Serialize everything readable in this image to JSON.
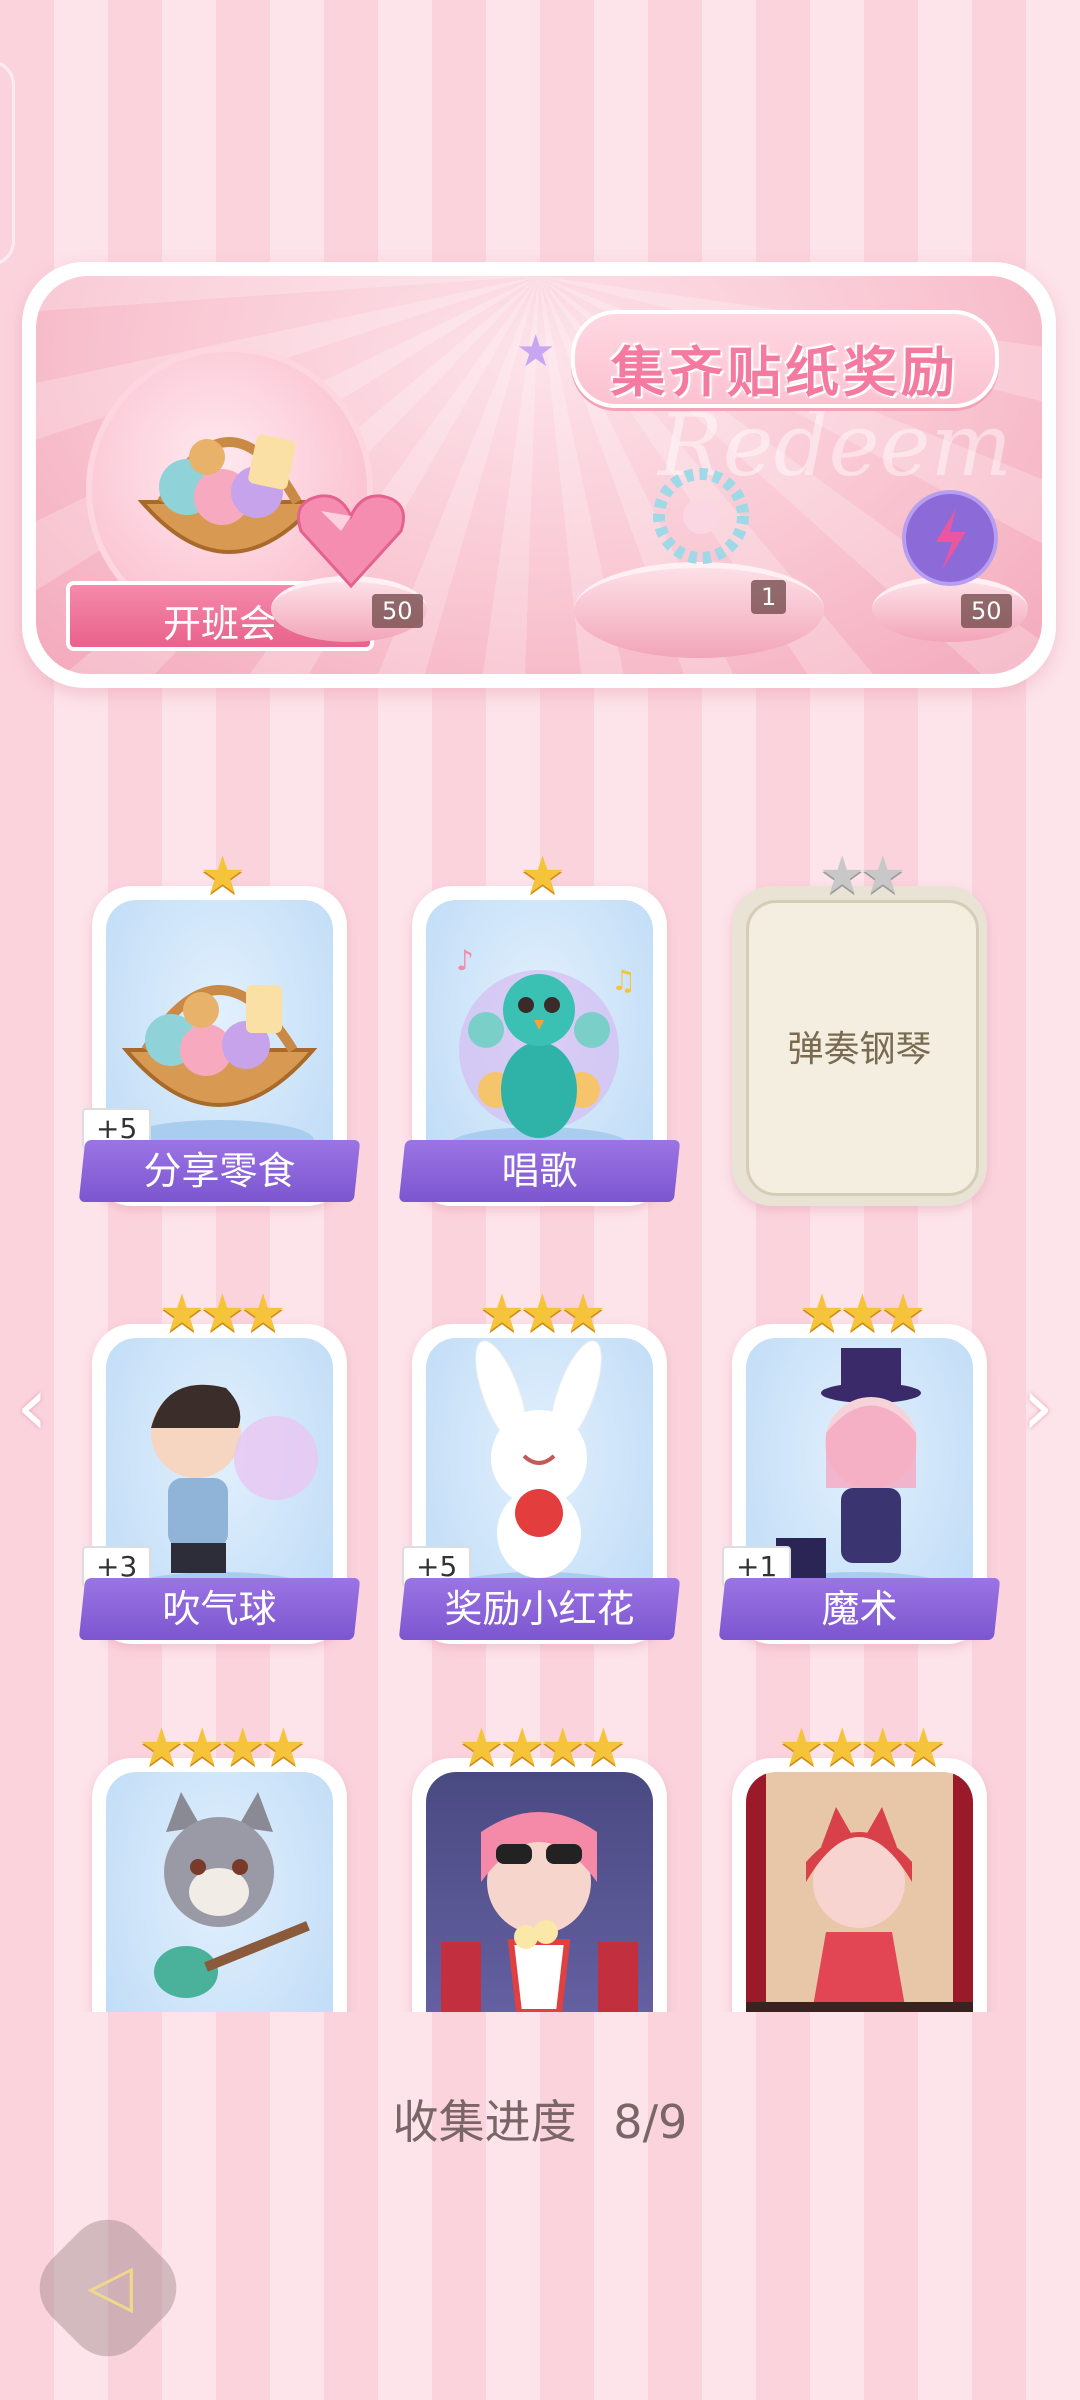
{
  "banner": {
    "title": "集齐贴纸奖励",
    "watermark": "Redeem",
    "event_name": "开班会",
    "rewards": [
      {
        "icon": "heart-gem-icon",
        "count": "50"
      },
      {
        "icon": "bracelet-icon",
        "count": "1"
      },
      {
        "icon": "purple-orb-icon",
        "count": "50"
      }
    ]
  },
  "cards": [
    {
      "name": "分享零食",
      "stars": "★",
      "bonus": "+5",
      "icon": "snack-basket-icon",
      "locked": false
    },
    {
      "name": "唱歌",
      "stars": "★",
      "bonus": "",
      "icon": "peacock-icon",
      "locked": false
    },
    {
      "name": "弹奏钢琴",
      "stars": "★★",
      "bonus": "",
      "icon": "locked-card",
      "locked": true
    },
    {
      "name": "吹气球",
      "stars": "★★★",
      "bonus": "+3",
      "icon": "boy-balloon-icon",
      "locked": false
    },
    {
      "name": "奖励小红花",
      "stars": "★★★",
      "bonus": "+5",
      "icon": "bunny-flower-icon",
      "locked": false
    },
    {
      "name": "魔术",
      "stars": "★★★",
      "bonus": "+1",
      "icon": "magician-girl-icon",
      "locked": false
    },
    {
      "name": "",
      "stars": "★★★★",
      "bonus": "",
      "icon": "wolf-guitar-icon",
      "locked": false
    },
    {
      "name": "",
      "stars": "★★★★",
      "bonus": "",
      "icon": "girl-popcorn-icon",
      "locked": false
    },
    {
      "name": "",
      "stars": "★★★★",
      "bonus": "",
      "icon": "cat-stage-icon",
      "locked": false
    }
  ],
  "progress": {
    "label": "收集进度",
    "value": "8/9"
  },
  "nav": {
    "left": "‹",
    "right": "›",
    "back": "◁"
  }
}
